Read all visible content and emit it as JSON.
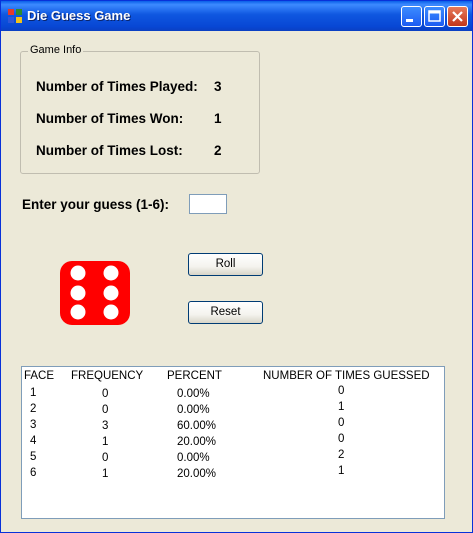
{
  "window": {
    "title": "Die Guess Game"
  },
  "game_info": {
    "group_title": "Game Info",
    "played_label": "Number of Times Played:",
    "played_value": "3",
    "won_label": "Number of Times Won:",
    "won_value": "1",
    "lost_label": "Number of Times Lost:",
    "lost_value": "2"
  },
  "guess": {
    "label": "Enter your guess (1-6):",
    "value": ""
  },
  "buttons": {
    "roll": "Roll",
    "reset": "Reset"
  },
  "die": {
    "face": 6,
    "color": "#ff0000"
  },
  "stats": {
    "headers": [
      "FACE",
      "FREQUENCY",
      "PERCENT",
      "NUMBER OF TIMES GUESSED"
    ],
    "rows": [
      [
        "1",
        "0",
        "0.00%",
        "0"
      ],
      [
        "2",
        "0",
        "0.00%",
        "1"
      ],
      [
        "3",
        "3",
        "60.00%",
        "0"
      ],
      [
        "4",
        "1",
        "20.00%",
        "0"
      ],
      [
        "5",
        "0",
        "0.00%",
        "2"
      ],
      [
        "6",
        "1",
        "20.00%",
        "1"
      ]
    ]
  }
}
